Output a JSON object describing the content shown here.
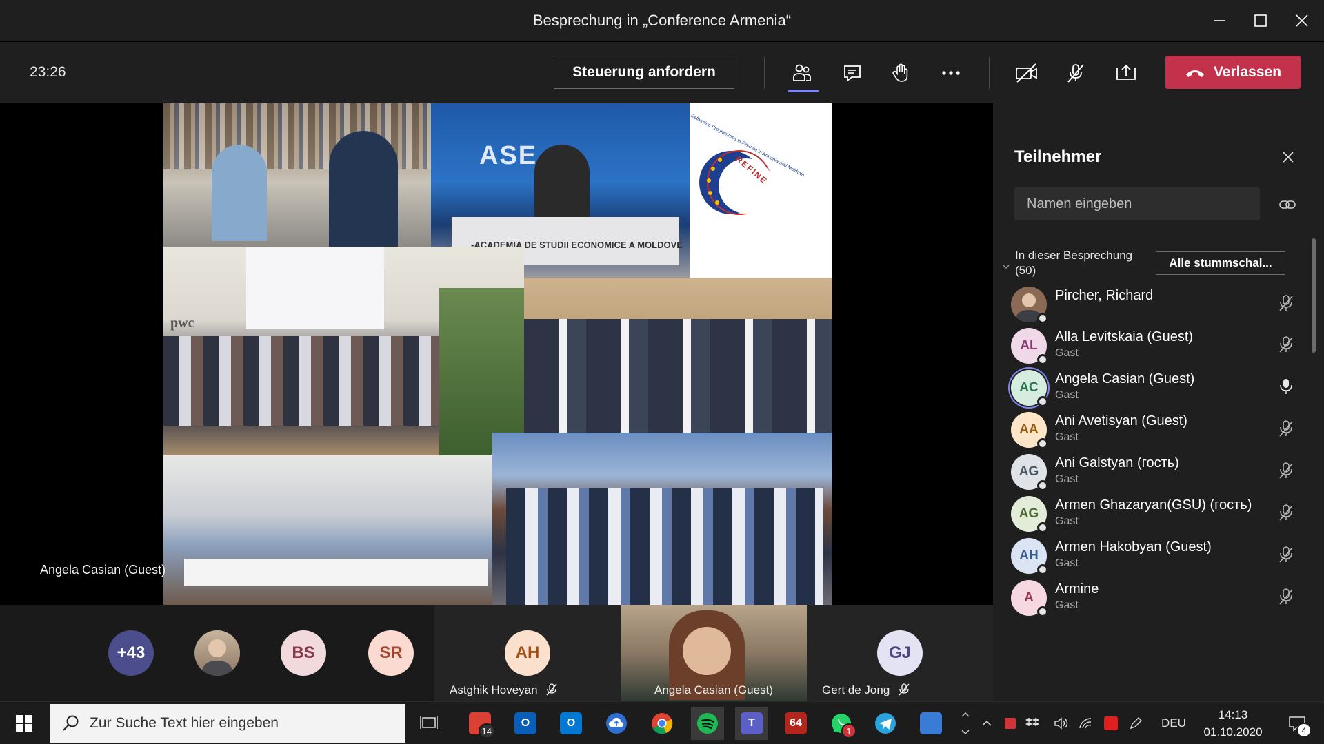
{
  "window": {
    "title": "Besprechung in „Conference Armenia“"
  },
  "toolbar": {
    "timer": "23:26",
    "request_control": "Steuerung anfordern",
    "leave": "Verlassen"
  },
  "stage": {
    "speaker_label": "Angela Casian (Guest)",
    "photo_captions": {
      "studio": "-ACADEMIA DE STUDII ECONOMICE A MOLDOVE",
      "studio_logo": "ASE",
      "sign": "pwc",
      "refine_logo": "REFINE",
      "refine_ring": "Reforming Programmes in Finance in Armenia and Moldova"
    }
  },
  "strip": {
    "overflow_count": "+43",
    "avatars": [
      {
        "initials": "BS",
        "bg": "#f1d9dc",
        "fg": "#8a3a46"
      },
      {
        "initials": "SR",
        "bg": "#fbdad2",
        "fg": "#a3442c"
      }
    ],
    "tiles": [
      {
        "initials": "AH",
        "name": "Astghik Hoveyan",
        "bg": "#fbe1cd",
        "fg": "#a14e17"
      },
      {
        "name": "Angela Casian (Guest)"
      },
      {
        "initials": "GJ",
        "name": "Gert de Jong",
        "bg": "#e4e3f3",
        "fg": "#4a4785"
      }
    ]
  },
  "panel": {
    "title": "Teilnehmer",
    "search_placeholder": "Namen eingeben",
    "section_label": "In dieser Besprechung (50)",
    "mute_all": "Alle stummschal...",
    "participants": [
      {
        "initials": "",
        "name": "Pircher, Richard",
        "sub": "",
        "bg": "#8a6a55",
        "fg": "#fff",
        "mic": "muted"
      },
      {
        "initials": "AL",
        "name": "Alla Levitskaia (Guest)",
        "sub": "Gast",
        "bg": "#efd8e8",
        "fg": "#8a3b74",
        "mic": "muted"
      },
      {
        "initials": "AC",
        "name": "Angela Casian (Guest)",
        "sub": "Gast",
        "bg": "#d5ecdf",
        "fg": "#2d7350",
        "mic": "on"
      },
      {
        "initials": "AA",
        "name": "Ani Avetisyan (Guest)",
        "sub": "Gast",
        "bg": "#fde6c8",
        "fg": "#9a5a12",
        "mic": "muted"
      },
      {
        "initials": "AG",
        "name": "Ani Galstyan (гость)",
        "sub": "Gast",
        "bg": "#dfe3e8",
        "fg": "#485563",
        "mic": "muted"
      },
      {
        "initials": "AG",
        "name": "Armen Ghazaryan(GSU) (гость)",
        "sub": "Gast",
        "bg": "#e2ecd9",
        "fg": "#4b6a33",
        "mic": "muted"
      },
      {
        "initials": "AH",
        "name": "Armen Hakobyan (Guest)",
        "sub": "Gast",
        "bg": "#dae4f2",
        "fg": "#395c8a",
        "mic": "muted"
      },
      {
        "initials": "A",
        "name": "Armine",
        "sub": "Gast",
        "bg": "#f6d9e0",
        "fg": "#9a3651",
        "mic": "muted"
      }
    ]
  },
  "taskbar": {
    "search_placeholder": "Zur Suche Text hier eingeben",
    "apps": [
      {
        "name": "task-view",
        "label": ""
      },
      {
        "name": "todoist",
        "label": "",
        "color": "#db4035",
        "badge": "14"
      },
      {
        "name": "outlook-o",
        "label": "O",
        "color": "#0a5eb8"
      },
      {
        "name": "outlook",
        "label": "O",
        "color": "#0078d4"
      },
      {
        "name": "cloud-upload",
        "label": "",
        "color": "#2f6fd1"
      },
      {
        "name": "chrome",
        "label": "",
        "color": "#4285f4"
      },
      {
        "name": "spotify",
        "label": "",
        "color": "#1db954"
      },
      {
        "name": "teams",
        "label": "T",
        "color": "#5b5fc7"
      },
      {
        "name": "red-app",
        "label": "64",
        "color": "#b3261e"
      },
      {
        "name": "whatsapp",
        "label": "",
        "color": "#25d366",
        "badge": "1"
      },
      {
        "name": "telegram",
        "label": "",
        "color": "#2aa3dc"
      },
      {
        "name": "network-app",
        "label": "",
        "color": "#3a7bd5"
      }
    ],
    "language": "DEU",
    "time": "14:13",
    "date": "01.10.2020",
    "notifications": "4"
  }
}
